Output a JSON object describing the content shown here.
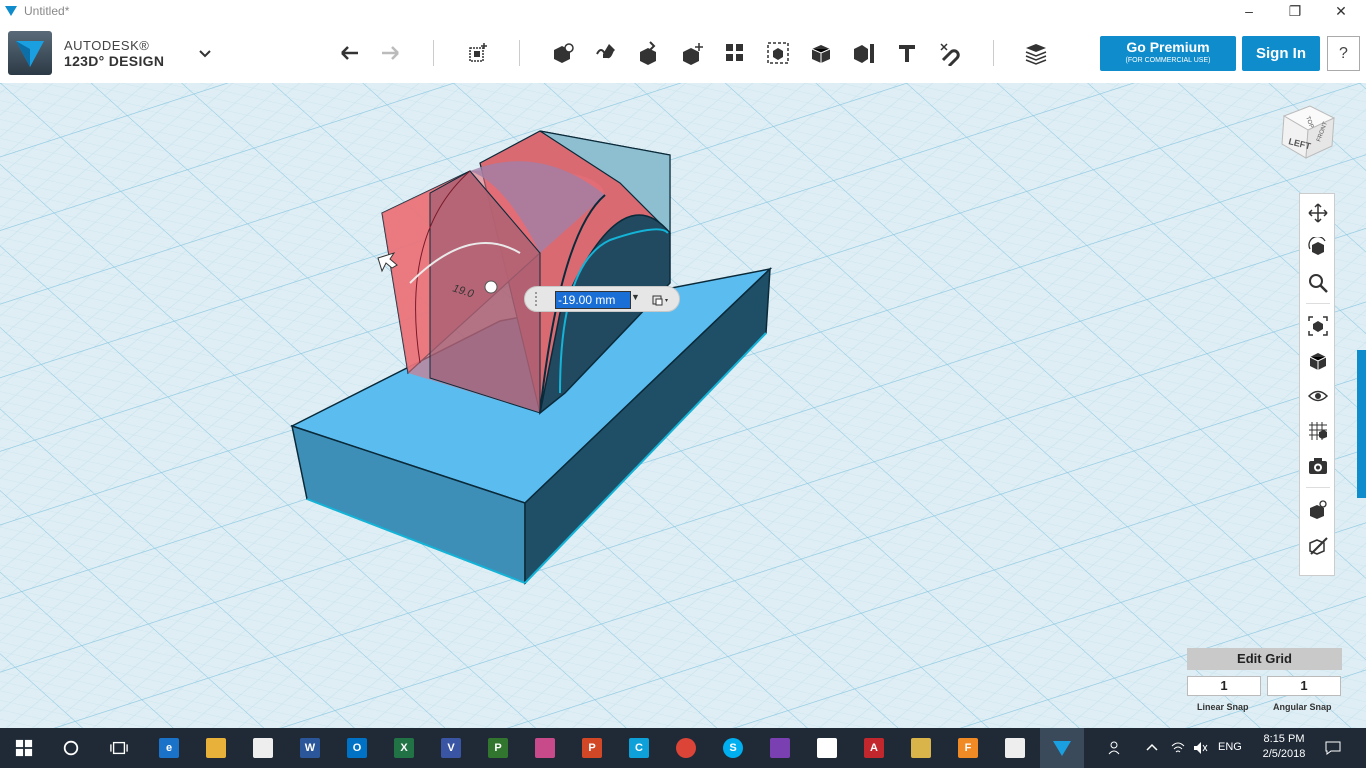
{
  "window": {
    "title": "Untitled*"
  },
  "app": {
    "brand_line1": "AUTODESK®",
    "brand_line2": "123D° DESIGN"
  },
  "toolbar": {
    "premium_label": "Go Premium",
    "premium_sub": "(FOR COMMERCIAL USE)",
    "signin_label": "Sign In",
    "help_label": "?"
  },
  "dimension": {
    "value": "-19.00 mm",
    "ghost_label": "19.0"
  },
  "viewcube": {
    "left_face": "LEFT",
    "front_face": "FRONT",
    "top_face": "TOP"
  },
  "grid": {
    "edit_label": "Edit Grid",
    "linear_snap": "1",
    "angular_snap": "1",
    "linear_label": "Linear Snap",
    "angular_label": "Angular Snap"
  },
  "taskbar": {
    "lang": "ENG",
    "time": "8:15 PM",
    "date": "2/5/2018"
  },
  "colors": {
    "accent": "#0f8ccc",
    "solid": "#5bbcf0",
    "selection": "#f07878",
    "grid": "#9fd3e8",
    "taskbar": "#1f2a36"
  }
}
